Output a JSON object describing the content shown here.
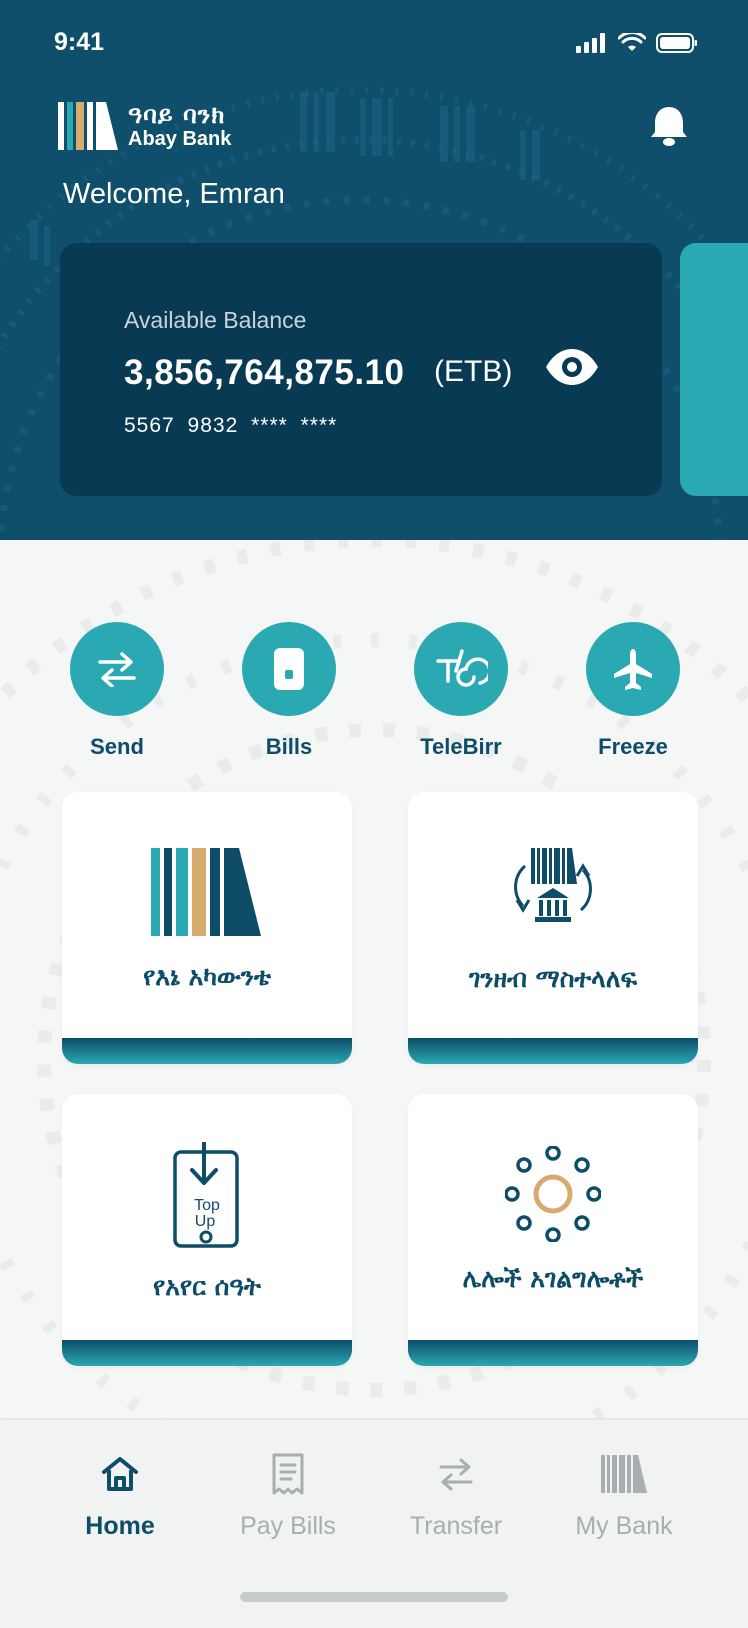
{
  "status_bar": {
    "time": "9:41"
  },
  "header": {
    "logo_amharic": "ዓባይ ባንክ",
    "logo_english": "Abay Bank",
    "welcome": "Welcome, Emran"
  },
  "balance_card": {
    "label": "Available Balance",
    "amount": "3,856,764,875.10",
    "currency": "(ETB)",
    "card_number": "5567 9832 **** ****"
  },
  "quick_actions": [
    {
      "label": "Send",
      "icon": "transfer-arrows-icon"
    },
    {
      "label": "Bills",
      "icon": "phone-bill-icon"
    },
    {
      "label": "TeleBirr",
      "icon": "telebirr-icon"
    },
    {
      "label": "Freeze",
      "icon": "airplane-icon"
    }
  ],
  "tiles": [
    {
      "label": "የእኔ አካውንቴ",
      "icon": "abay-logo-icon"
    },
    {
      "label": "ገንዘብ ማስተላለፍ",
      "icon": "bank-exchange-icon"
    },
    {
      "label": "የአየር ሰዓት",
      "icon": "top-up-icon",
      "icon_text_1": "Top",
      "icon_text_2": "Up"
    },
    {
      "label": "ሌሎች አገልግሎቶች",
      "icon": "more-services-icon"
    }
  ],
  "bottom_nav": [
    {
      "label": "Home",
      "icon": "home-icon",
      "active": true
    },
    {
      "label": "Pay Bills",
      "icon": "receipt-icon",
      "active": false
    },
    {
      "label": "Transfer",
      "icon": "transfer-icon",
      "active": false
    },
    {
      "label": "My Bank",
      "icon": "bank-logo-icon",
      "active": false
    }
  ],
  "colors": {
    "primary": "#0f4f6c",
    "card": "#093a53",
    "accent": "#2aa9b3",
    "gold": "#d6ab6d",
    "inactive": "#a9aeb1"
  }
}
